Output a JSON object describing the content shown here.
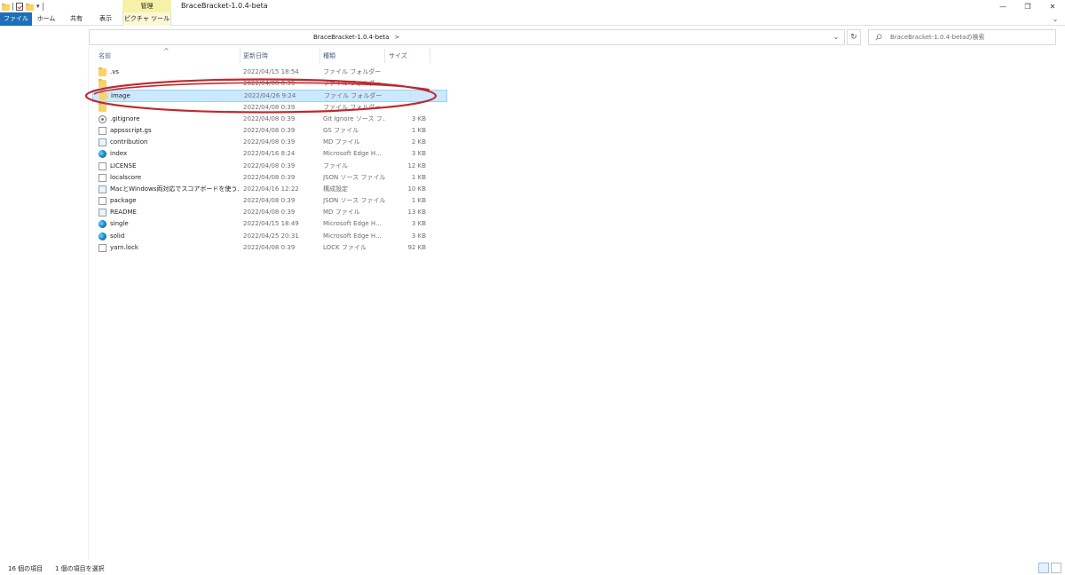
{
  "window": {
    "title": "BraceBracket-1.0.4-beta",
    "manage_tab": "管理",
    "controls": {
      "minimize": "—",
      "restore": "❐",
      "close": "✕"
    }
  },
  "ribbon": {
    "tabs": [
      {
        "label": "ファイル"
      },
      {
        "label": "ホーム"
      },
      {
        "label": "共有"
      },
      {
        "label": "表示"
      },
      {
        "label": "ピクチャ ツール"
      }
    ],
    "expand_icon": "chevron-down"
  },
  "address": {
    "path": "BraceBracket-1.0.4-beta",
    "separator": ">",
    "dropdown_glyph": "⌄",
    "refresh_glyph": "↻",
    "search_placeholder": "BraceBracket-1.0.4-betaの検索"
  },
  "columns": {
    "name": "名前",
    "date": "更新日時",
    "type": "種類",
    "size": "サイズ",
    "sort_glyph": "^"
  },
  "files": [
    {
      "name": ".vs",
      "date": "2022/04/15 18:54",
      "type": "ファイル フォルダー",
      "size": "",
      "icon": "folder"
    },
    {
      "name": "",
      "date": "2022/04/08 0:39",
      "type": "ファイル フォルダー",
      "size": "",
      "icon": "folder"
    },
    {
      "name": "image",
      "date": "2022/04/26 9:24",
      "type": "ファイル フォルダー",
      "size": "",
      "icon": "folder",
      "selected": true
    },
    {
      "name": "",
      "date": "2022/04/08 0:39",
      "type": "ファイル フォルダー",
      "size": "",
      "icon": "folder"
    },
    {
      "name": ".gitignore",
      "date": "2022/04/08 0:39",
      "type": "Git Ignore ソース フ...",
      "size": "3 KB",
      "icon": "gear"
    },
    {
      "name": "appsscript.gs",
      "date": "2022/04/08 0:39",
      "type": "GS ファイル",
      "size": "1 KB",
      "icon": "doc"
    },
    {
      "name": "contribution",
      "date": "2022/04/08 0:39",
      "type": "MD ファイル",
      "size": "2 KB",
      "icon": "cfg"
    },
    {
      "name": "index",
      "date": "2022/04/16 8:24",
      "type": "Microsoft Edge H...",
      "size": "3 KB",
      "icon": "edge"
    },
    {
      "name": "LICENSE",
      "date": "2022/04/08 0:39",
      "type": "ファイル",
      "size": "12 KB",
      "icon": "doc"
    },
    {
      "name": "localscore",
      "date": "2022/04/08 0:39",
      "type": "JSON ソース ファイル",
      "size": "1 KB",
      "icon": "doc"
    },
    {
      "name": "MacとWindows両対応でスコアボードを使う...",
      "date": "2022/04/16 12:22",
      "type": "構成設定",
      "size": "10 KB",
      "icon": "cfg"
    },
    {
      "name": "package",
      "date": "2022/04/08 0:39",
      "type": "JSON ソース ファイル",
      "size": "1 KB",
      "icon": "doc"
    },
    {
      "name": "README",
      "date": "2022/04/08 0:39",
      "type": "MD ファイル",
      "size": "13 KB",
      "icon": "cfg"
    },
    {
      "name": "single",
      "date": "2022/04/15 18:49",
      "type": "Microsoft Edge H...",
      "size": "3 KB",
      "icon": "edge"
    },
    {
      "name": "solid",
      "date": "2022/04/25 20:31",
      "type": "Microsoft Edge H...",
      "size": "3 KB",
      "icon": "edge"
    },
    {
      "name": "yarn.lock",
      "date": "2022/04/08 0:39",
      "type": "LOCK ファイル",
      "size": "92 KB",
      "icon": "doc"
    }
  ],
  "status": {
    "count": "16 個の項目",
    "selection": "1 個の項目を選択"
  },
  "colors": {
    "accent": "#1f6eb7",
    "selection": "#cce8ff",
    "annotation": "#c0282d"
  }
}
